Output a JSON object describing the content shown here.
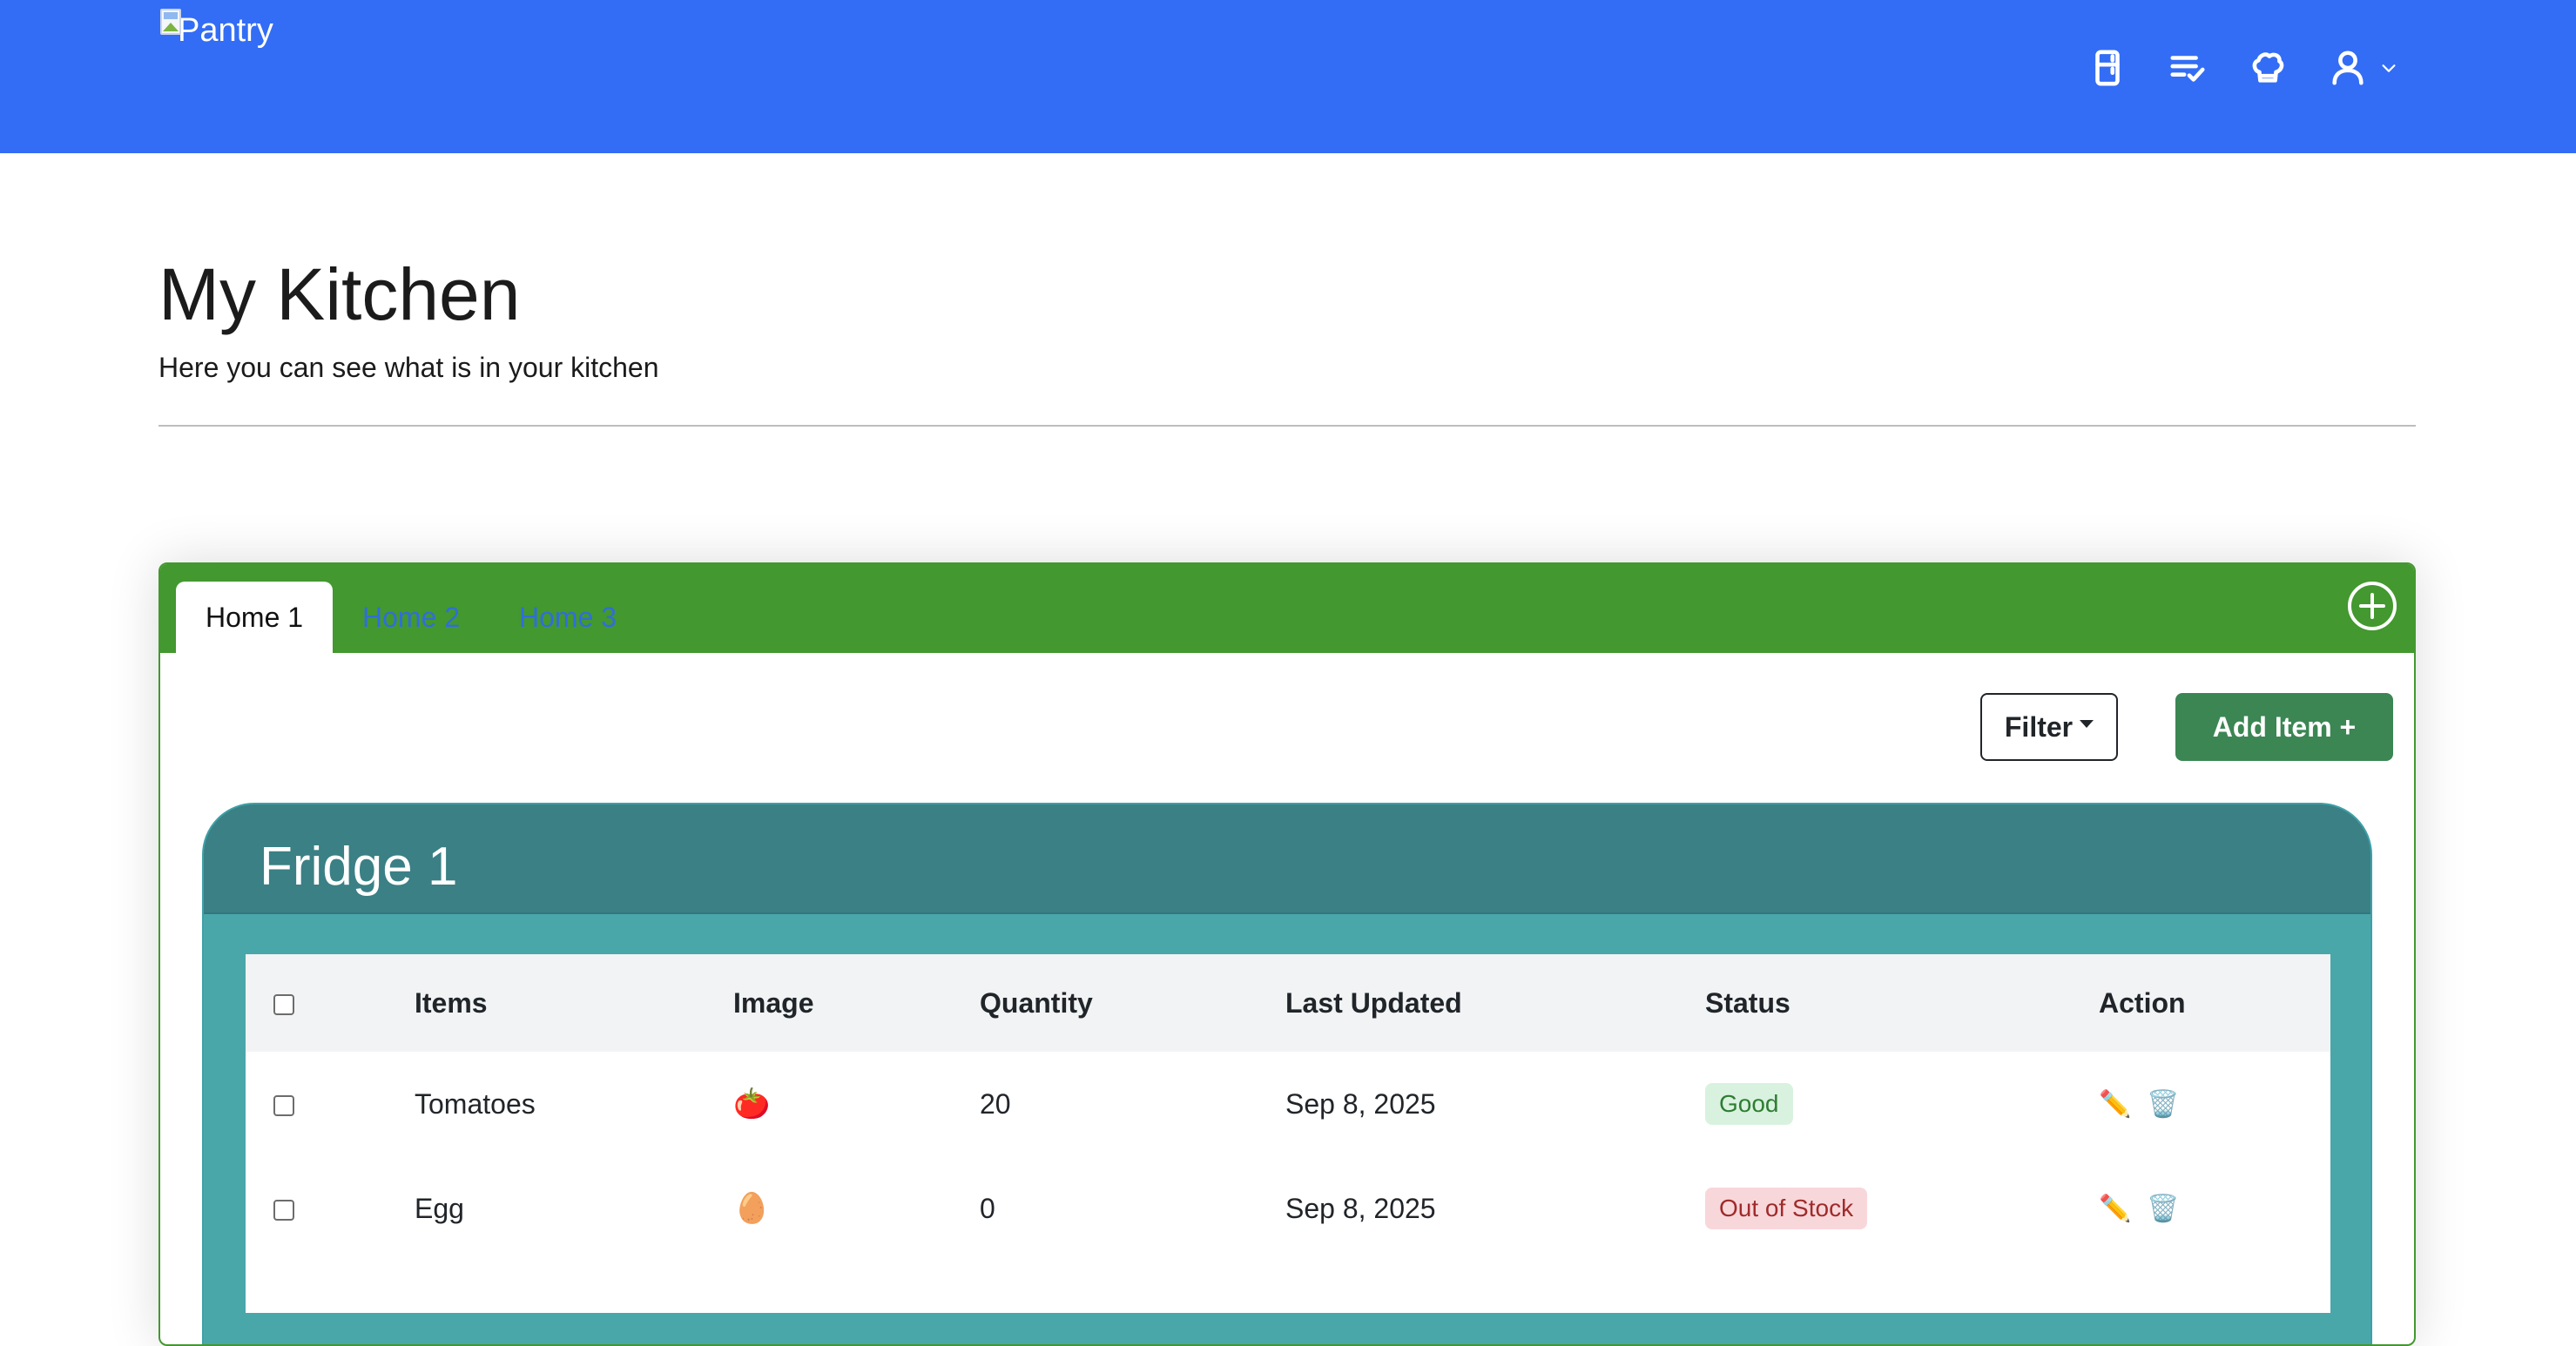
{
  "navbar": {
    "brand_alt": "Pantry",
    "color": "#336df5",
    "icons": [
      "fridge-icon",
      "checklist-icon",
      "chef-hat-icon",
      "user-icon",
      "chevron-down-icon"
    ]
  },
  "header": {
    "title": "My Kitchen",
    "subtitle": "Here you can see what is in your kitchen"
  },
  "kitchen": {
    "tabs": [
      {
        "label": "Home 1",
        "active": true
      },
      {
        "label": "Home 2",
        "active": false
      },
      {
        "label": "Home 3",
        "active": false
      }
    ],
    "add_home_icon": "plus-circle-icon",
    "filter_label": "Filter",
    "add_item_label": "Add Item +",
    "accent": "#43982f"
  },
  "fridge": {
    "title": "Fridge 1",
    "columns": [
      "Items",
      "Image",
      "Quantity",
      "Last Updated",
      "Status",
      "Action"
    ],
    "rows": [
      {
        "item": "Tomatoes",
        "image": "🍅",
        "quantity": "20",
        "updated": "Sep 8, 2025",
        "status": "Good"
      },
      {
        "item": "Egg",
        "image": "🥚",
        "quantity": "0",
        "updated": "Sep 8, 2025",
        "status": "Out of Stock"
      }
    ],
    "action_icons": {
      "edit": "✏️",
      "delete": "🗑️"
    }
  }
}
